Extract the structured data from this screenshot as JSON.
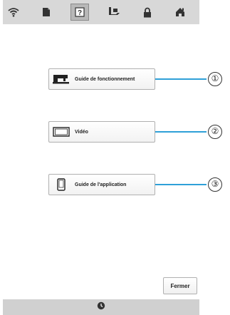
{
  "toolbar": {
    "icons": [
      "wifi-icon",
      "document-icon",
      "help-icon",
      "sewing-foot-icon",
      "lock-icon",
      "home-icon"
    ],
    "active_index": 2
  },
  "menu": {
    "buttons": [
      {
        "label": "Guide de fonctionnement",
        "icon": "sewing-machine-icon",
        "callout": "①"
      },
      {
        "label": "Vidéo",
        "icon": "video-icon",
        "callout": "②"
      },
      {
        "label": "Guide de l'application",
        "icon": "smartphone-icon",
        "callout": "③"
      }
    ]
  },
  "footer": {
    "close_label": "Fermer",
    "status_icon": "clock-icon"
  },
  "colors": {
    "toolbar_bg": "#d8d8d8",
    "callout_line": "#2fa0d8",
    "status_bg": "#d0d0d0"
  }
}
